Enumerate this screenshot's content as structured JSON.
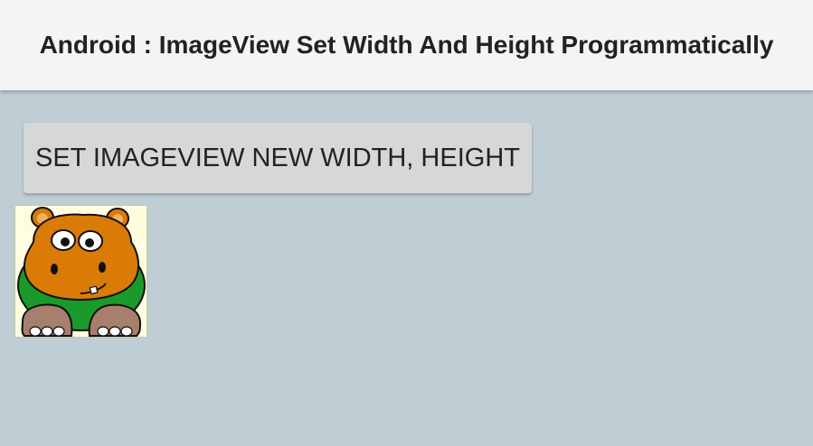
{
  "app_bar": {
    "title": "Android : ImageView Set Width And Height Programmatically"
  },
  "main": {
    "set_size_button_label": "SET IMAGEVIEW NEW WIDTH, HEIGHT",
    "image_view": {
      "icon": "hippo-cartoon-image"
    }
  },
  "colors": {
    "app_bar_background": "#f4f4f4",
    "content_background": "#bfced4",
    "button_background": "#d6d7d7",
    "hippo_body": "#d97b06",
    "hippo_shirt": "#1a9a2a",
    "hippo_feet": "#a87e6c"
  }
}
